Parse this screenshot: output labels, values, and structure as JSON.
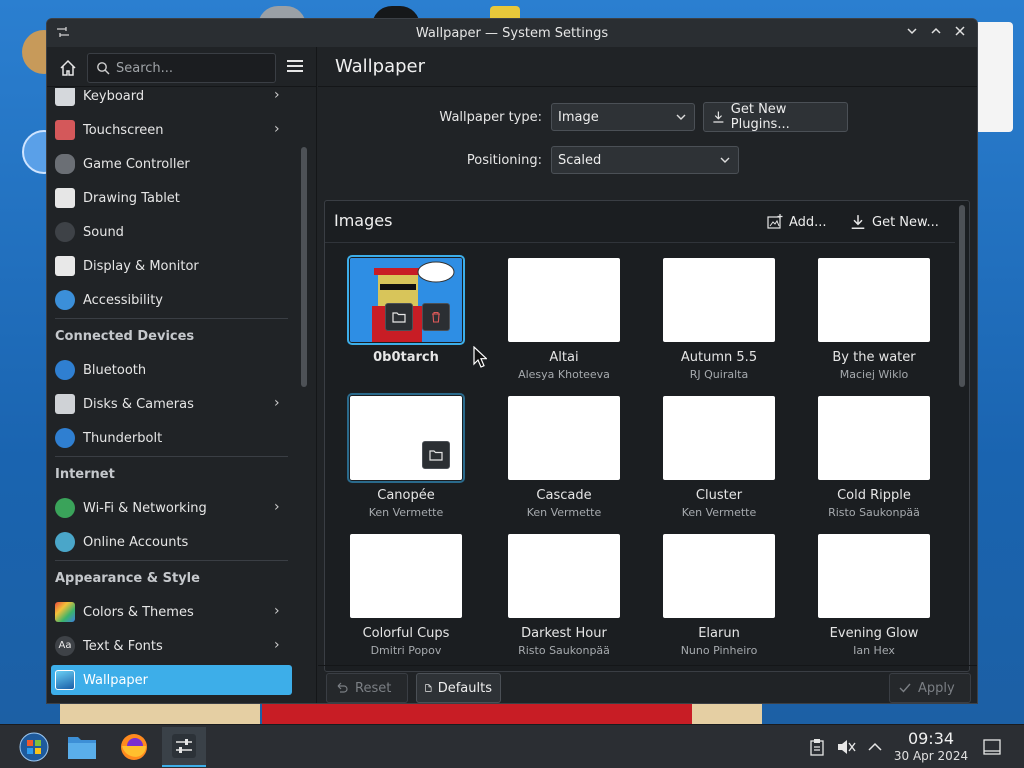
{
  "window": {
    "title": "Wallpaper — System Settings"
  },
  "search": {
    "placeholder": "Search..."
  },
  "sidebar": {
    "items": [
      {
        "label": "Keyboard"
      },
      {
        "label": "Touchscreen"
      },
      {
        "label": "Game Controller"
      },
      {
        "label": "Drawing Tablet"
      },
      {
        "label": "Sound"
      },
      {
        "label": "Display & Monitor"
      },
      {
        "label": "Accessibility"
      },
      {
        "label": "Bluetooth"
      },
      {
        "label": "Disks & Cameras"
      },
      {
        "label": "Thunderbolt"
      },
      {
        "label": "Wi-Fi & Networking"
      },
      {
        "label": "Online Accounts"
      },
      {
        "label": "Colors & Themes"
      },
      {
        "label": "Text & Fonts"
      },
      {
        "label": "Wallpaper"
      }
    ],
    "categories": {
      "connected_devices": "Connected Devices",
      "internet": "Internet",
      "appearance": "Appearance & Style"
    }
  },
  "main": {
    "title": "Wallpaper",
    "wallpaper_type_label": "Wallpaper type:",
    "wallpaper_type_value": "Image",
    "get_new_plugins": "Get New Plugins...",
    "positioning_label": "Positioning:",
    "positioning_value": "Scaled",
    "images_title": "Images",
    "add_label": "Add...",
    "get_new_label": "Get New..."
  },
  "images": [
    {
      "name": "0b0tarch",
      "author": ""
    },
    {
      "name": "Altai",
      "author": "Alesya Khoteeva"
    },
    {
      "name": "Autumn 5.5",
      "author": "RJ Quiralta"
    },
    {
      "name": "By the water",
      "author": "Maciej Wiklo"
    },
    {
      "name": "Canopée",
      "author": "Ken Vermette"
    },
    {
      "name": "Cascade",
      "author": "Ken Vermette"
    },
    {
      "name": "Cluster",
      "author": "Ken Vermette"
    },
    {
      "name": "Cold Ripple",
      "author": "Risto Saukonpää"
    },
    {
      "name": "Colorful Cups",
      "author": "Dmitri Popov"
    },
    {
      "name": "Darkest Hour",
      "author": "Risto Saukonpää"
    },
    {
      "name": "Elarun",
      "author": "Nuno Pinheiro"
    },
    {
      "name": "Evening Glow",
      "author": "Ian Hex"
    }
  ],
  "footer": {
    "reset": "Reset",
    "defaults": "Defaults",
    "apply": "Apply"
  },
  "taskbar": {
    "time": "09:34",
    "date": "30 Apr 2024"
  },
  "colors": {
    "accent": "#3daee9",
    "window_bg": "#202326",
    "panel_bg": "#1b1e21"
  }
}
